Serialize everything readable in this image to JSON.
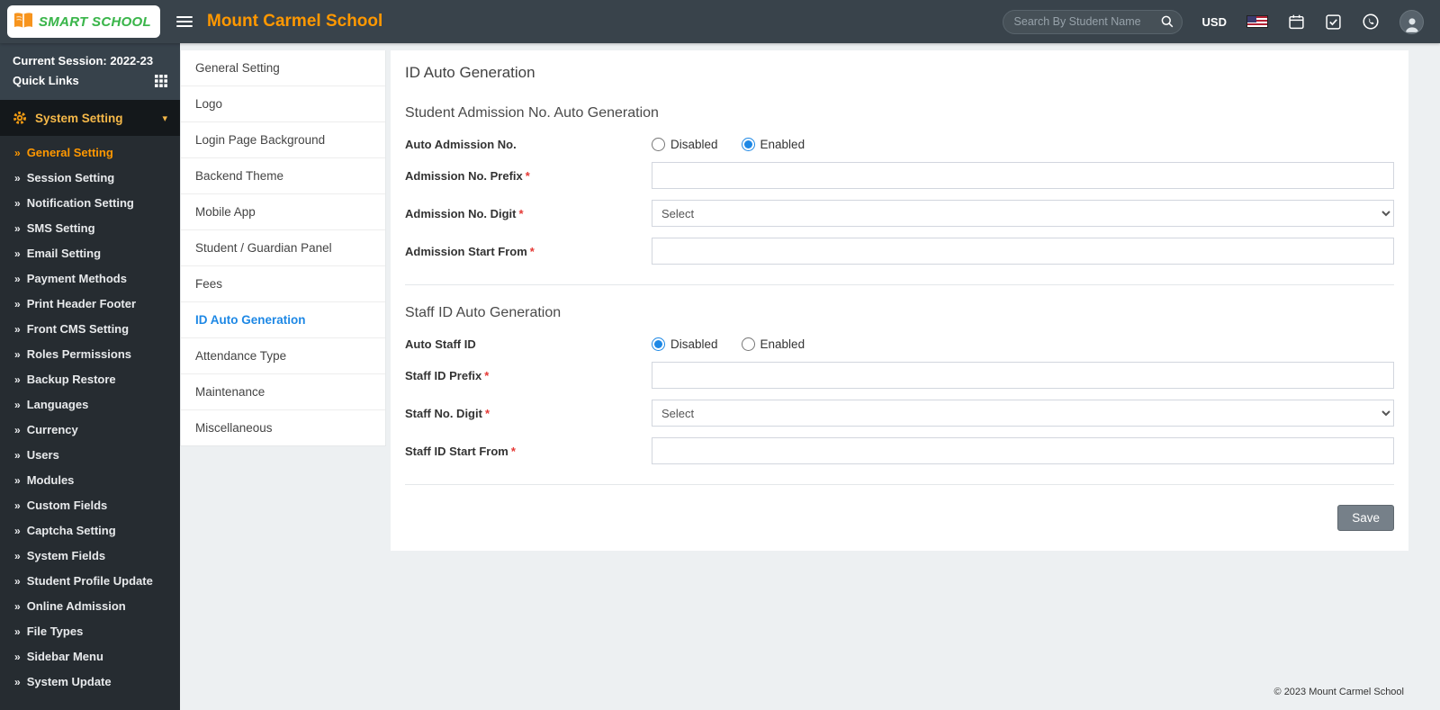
{
  "topbar": {
    "brand": "SMART SCHOOL",
    "school_name": "Mount Carmel School",
    "search_placeholder": "Search By Student Name",
    "currency_label": "USD"
  },
  "sidebar": {
    "session_label": "Current Session: 2022-23",
    "quick_links_label": "Quick Links",
    "section_title": "System Setting",
    "active_item": "General Setting",
    "items": [
      "General Setting",
      "Session Setting",
      "Notification Setting",
      "SMS Setting",
      "Email Setting",
      "Payment Methods",
      "Print Header Footer",
      "Front CMS Setting",
      "Roles Permissions",
      "Backup Restore",
      "Languages",
      "Currency",
      "Users",
      "Modules",
      "Custom Fields",
      "Captcha Setting",
      "System Fields",
      "Student Profile Update",
      "Online Admission",
      "File Types",
      "Sidebar Menu",
      "System Update"
    ]
  },
  "settings_tabs": {
    "active_item": "ID Auto Generation",
    "items": [
      "General Setting",
      "Logo",
      "Login Page Background",
      "Backend Theme",
      "Mobile App",
      "Student / Guardian Panel",
      "Fees",
      "ID Auto Generation",
      "Attendance Type",
      "Maintenance",
      "Miscellaneous"
    ]
  },
  "main": {
    "page_title": "ID Auto Generation",
    "required_marker": "*",
    "student_section": {
      "title": "Student Admission No. Auto Generation",
      "auto_label": "Auto Admission No.",
      "radio_disabled": "Disabled",
      "radio_enabled": "Enabled",
      "radio_selected": "Enabled",
      "prefix_label": "Admission No. Prefix",
      "prefix_value": "",
      "digit_label": "Admission No. Digit",
      "digit_value": "Select",
      "start_label": "Admission Start From",
      "start_value": ""
    },
    "staff_section": {
      "title": "Staff ID Auto Generation",
      "auto_label": "Auto Staff ID",
      "radio_disabled": "Disabled",
      "radio_enabled": "Enabled",
      "radio_selected": "Disabled",
      "prefix_label": "Staff ID Prefix",
      "prefix_value": "",
      "digit_label": "Staff No. Digit",
      "digit_value": "Select",
      "start_label": "Staff ID Start From",
      "start_value": ""
    },
    "save_label": "Save"
  },
  "footer": {
    "copyright": "© 2023 Mount Carmel School"
  },
  "icons": {
    "menu_arrow": "»",
    "chevron_down": "▾"
  },
  "colors": {
    "accent_orange": "#ff9800",
    "brand_green": "#3ab54a",
    "active_blue": "#1e88e5",
    "topbar_bg": "#39434b",
    "sidebar_bg": "#262c31",
    "required_red": "#e53935",
    "save_gray": "#768089"
  }
}
